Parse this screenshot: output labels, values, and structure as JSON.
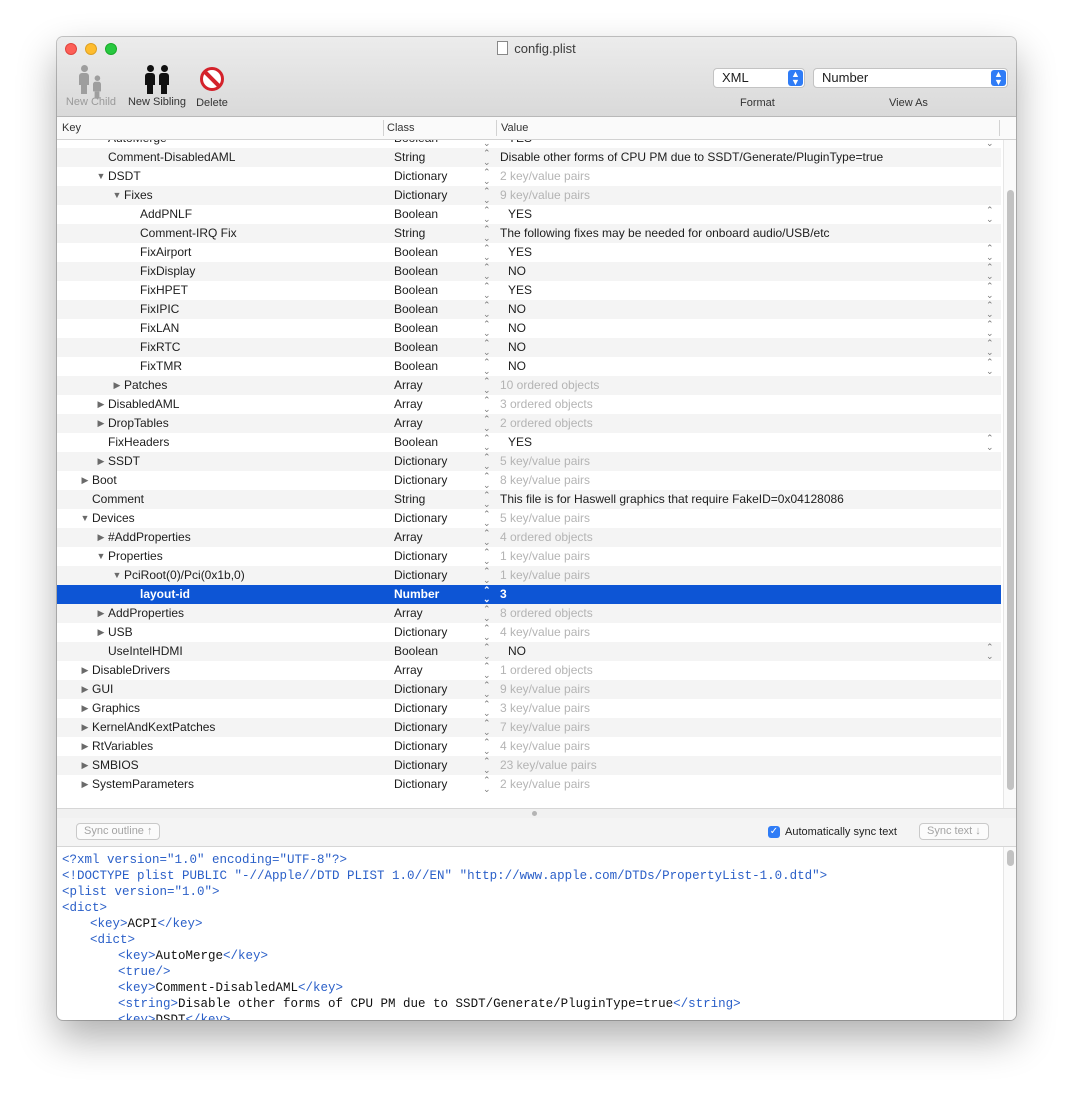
{
  "window": {
    "title": "config.plist"
  },
  "toolbar": {
    "new_child": "New Child",
    "new_sibling": "New Sibling",
    "delete": "Delete",
    "format_value": "XML",
    "format_label": "Format",
    "viewas_value": "Number",
    "viewas_label": "View As"
  },
  "columns": {
    "key": "Key",
    "class": "Class",
    "value": "Value"
  },
  "rows": [
    {
      "key": "AutoMerge",
      "depth": 2,
      "tri": "",
      "cls": "Boolean",
      "val": "YES",
      "kind": "bool",
      "partial": true
    },
    {
      "key": "Comment-DisabledAML",
      "depth": 2,
      "tri": "",
      "cls": "String",
      "val": "Disable other forms of CPU PM due to SSDT/Generate/PluginType=true",
      "kind": "text"
    },
    {
      "key": "DSDT",
      "depth": 2,
      "tri": "open",
      "cls": "Dictionary",
      "val": "2 key/value pairs",
      "kind": "dim"
    },
    {
      "key": "Fixes",
      "depth": 3,
      "tri": "open",
      "cls": "Dictionary",
      "val": "9 key/value pairs",
      "kind": "dim"
    },
    {
      "key": "AddPNLF",
      "depth": 4,
      "tri": "",
      "cls": "Boolean",
      "val": "YES",
      "kind": "bool"
    },
    {
      "key": "Comment-IRQ Fix",
      "depth": 4,
      "tri": "",
      "cls": "String",
      "val": "The following fixes may be needed for onboard audio/USB/etc",
      "kind": "text"
    },
    {
      "key": "FixAirport",
      "depth": 4,
      "tri": "",
      "cls": "Boolean",
      "val": "YES",
      "kind": "bool"
    },
    {
      "key": "FixDisplay",
      "depth": 4,
      "tri": "",
      "cls": "Boolean",
      "val": "NO",
      "kind": "bool"
    },
    {
      "key": "FixHPET",
      "depth": 4,
      "tri": "",
      "cls": "Boolean",
      "val": "YES",
      "kind": "bool"
    },
    {
      "key": "FixIPIC",
      "depth": 4,
      "tri": "",
      "cls": "Boolean",
      "val": "NO",
      "kind": "bool"
    },
    {
      "key": "FixLAN",
      "depth": 4,
      "tri": "",
      "cls": "Boolean",
      "val": "NO",
      "kind": "bool"
    },
    {
      "key": "FixRTC",
      "depth": 4,
      "tri": "",
      "cls": "Boolean",
      "val": "NO",
      "kind": "bool"
    },
    {
      "key": "FixTMR",
      "depth": 4,
      "tri": "",
      "cls": "Boolean",
      "val": "NO",
      "kind": "bool"
    },
    {
      "key": "Patches",
      "depth": 3,
      "tri": "closed",
      "cls": "Array",
      "val": "10 ordered objects",
      "kind": "dim"
    },
    {
      "key": "DisabledAML",
      "depth": 2,
      "tri": "closed",
      "cls": "Array",
      "val": "3 ordered objects",
      "kind": "dim"
    },
    {
      "key": "DropTables",
      "depth": 2,
      "tri": "closed",
      "cls": "Array",
      "val": "2 ordered objects",
      "kind": "dim"
    },
    {
      "key": "FixHeaders",
      "depth": 2,
      "tri": "",
      "cls": "Boolean",
      "val": "YES",
      "kind": "bool"
    },
    {
      "key": "SSDT",
      "depth": 2,
      "tri": "closed",
      "cls": "Dictionary",
      "val": "5 key/value pairs",
      "kind": "dim"
    },
    {
      "key": "Boot",
      "depth": 1,
      "tri": "closed",
      "cls": "Dictionary",
      "val": "8 key/value pairs",
      "kind": "dim"
    },
    {
      "key": "Comment",
      "depth": 1,
      "tri": "",
      "cls": "String",
      "val": "This file is for Haswell graphics that require FakeID=0x04128086",
      "kind": "text"
    },
    {
      "key": "Devices",
      "depth": 1,
      "tri": "open",
      "cls": "Dictionary",
      "val": "5 key/value pairs",
      "kind": "dim"
    },
    {
      "key": "#AddProperties",
      "depth": 2,
      "tri": "closed",
      "cls": "Array",
      "val": "4 ordered objects",
      "kind": "dim"
    },
    {
      "key": "Properties",
      "depth": 2,
      "tri": "open",
      "cls": "Dictionary",
      "val": "1 key/value pairs",
      "kind": "dim"
    },
    {
      "key": "PciRoot(0)/Pci(0x1b,0)",
      "depth": 3,
      "tri": "open",
      "cls": "Dictionary",
      "val": "1 key/value pairs",
      "kind": "dim"
    },
    {
      "key": "layout-id",
      "depth": 4,
      "tri": "",
      "cls": "Number",
      "val": "3",
      "kind": "text",
      "selected": true
    },
    {
      "key": "AddProperties",
      "depth": 2,
      "tri": "closed",
      "cls": "Array",
      "val": "8 ordered objects",
      "kind": "dim"
    },
    {
      "key": "USB",
      "depth": 2,
      "tri": "closed",
      "cls": "Dictionary",
      "val": "4 key/value pairs",
      "kind": "dim"
    },
    {
      "key": "UseIntelHDMI",
      "depth": 2,
      "tri": "",
      "cls": "Boolean",
      "val": "NO",
      "kind": "bool"
    },
    {
      "key": "DisableDrivers",
      "depth": 1,
      "tri": "closed",
      "cls": "Array",
      "val": "1 ordered objects",
      "kind": "dim"
    },
    {
      "key": "GUI",
      "depth": 1,
      "tri": "closed",
      "cls": "Dictionary",
      "val": "9 key/value pairs",
      "kind": "dim"
    },
    {
      "key": "Graphics",
      "depth": 1,
      "tri": "closed",
      "cls": "Dictionary",
      "val": "3 key/value pairs",
      "kind": "dim"
    },
    {
      "key": "KernelAndKextPatches",
      "depth": 1,
      "tri": "closed",
      "cls": "Dictionary",
      "val": "7 key/value pairs",
      "kind": "dim"
    },
    {
      "key": "RtVariables",
      "depth": 1,
      "tri": "closed",
      "cls": "Dictionary",
      "val": "4 key/value pairs",
      "kind": "dim"
    },
    {
      "key": "SMBIOS",
      "depth": 1,
      "tri": "closed",
      "cls": "Dictionary",
      "val": "23 key/value pairs",
      "kind": "dim"
    },
    {
      "key": "SystemParameters",
      "depth": 1,
      "tri": "closed",
      "cls": "Dictionary",
      "val": "2 key/value pairs",
      "kind": "dim"
    }
  ],
  "sync": {
    "sync_outline": "Sync outline ↑",
    "auto_sync": "Automatically sync text",
    "sync_text": "Sync text ↓"
  },
  "xml_lines": [
    {
      "indent": 0,
      "tag": "<?xml version=\"1.0\" encoding=\"UTF-8\"?>",
      "text": "",
      "close": ""
    },
    {
      "indent": 0,
      "tag": "<!DOCTYPE plist PUBLIC \"-//Apple//DTD PLIST 1.0//EN\" \"http://www.apple.com/DTDs/PropertyList-1.0.dtd\">",
      "text": "",
      "close": ""
    },
    {
      "indent": 0,
      "tag": "<plist version=\"1.0\">",
      "text": "",
      "close": ""
    },
    {
      "indent": 0,
      "tag": "<dict>",
      "text": "",
      "close": ""
    },
    {
      "indent": 1,
      "tag": "<key>",
      "text": "ACPI",
      "close": "</key>"
    },
    {
      "indent": 1,
      "tag": "<dict>",
      "text": "",
      "close": ""
    },
    {
      "indent": 2,
      "tag": "<key>",
      "text": "AutoMerge",
      "close": "</key>"
    },
    {
      "indent": 2,
      "tag": "<true/>",
      "text": "",
      "close": ""
    },
    {
      "indent": 2,
      "tag": "<key>",
      "text": "Comment-DisabledAML",
      "close": "</key>"
    },
    {
      "indent": 2,
      "tag": "<string>",
      "text": "Disable other forms of CPU PM due to SSDT/Generate/PluginType=true",
      "close": "</string>"
    },
    {
      "indent": 2,
      "tag": "<key>",
      "text": "DSDT",
      "close": "</key>"
    }
  ]
}
